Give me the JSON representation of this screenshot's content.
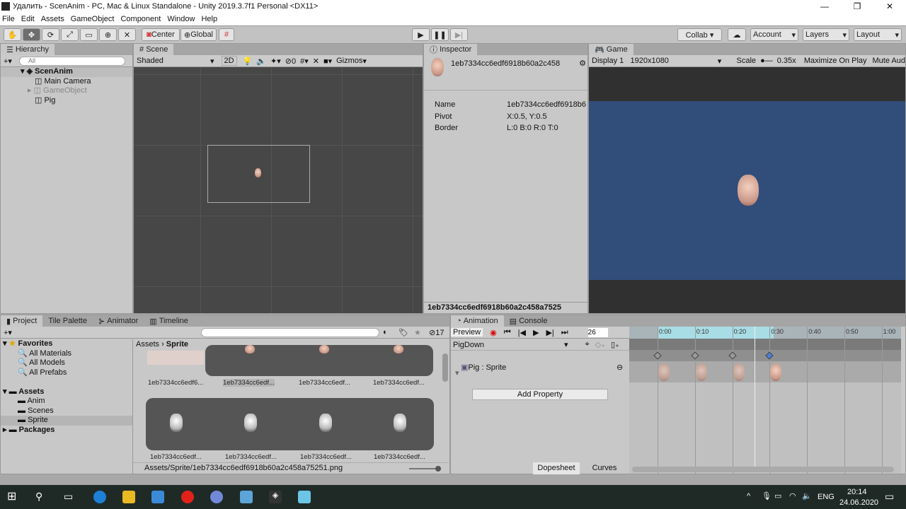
{
  "window": {
    "title": "Удалить - ScenAnim - PC, Mac & Linux Standalone - Unity 2019.3.7f1 Personal <DX11>",
    "controls": [
      "—",
      "❐",
      "✕"
    ]
  },
  "menu": [
    "File",
    "Edit",
    "Assets",
    "GameObject",
    "Component",
    "Window",
    "Help"
  ],
  "toolbar": {
    "tools": [
      "hand-tool",
      "move-tool",
      "rotate-tool",
      "scale-tool",
      "rect-tool",
      "transform-tool",
      "custom-tool"
    ],
    "center": "Center",
    "global": "Global",
    "collab": "Collab ▾",
    "account": "Account",
    "layers": "Layers",
    "layout": "Layout",
    "play_mode": "stopped"
  },
  "hierarchy": {
    "tab": "Hierarchy",
    "search_placeholder": "All",
    "items": [
      {
        "label": "ScenAnim",
        "depth": 0,
        "bold": true
      },
      {
        "label": "Main Camera",
        "depth": 1
      },
      {
        "label": "GameObject",
        "depth": 1,
        "disabled": true
      },
      {
        "label": "Pig",
        "depth": 1
      }
    ]
  },
  "scene": {
    "tab": "Scene",
    "shading": "Shaded",
    "mode2d": "2D",
    "hidden_count": "0",
    "gizmos": "Gizmos"
  },
  "inspector": {
    "tab": "Inspector",
    "asset_name": "1eb7334cc6edf6918b60a2c458",
    "fields": [
      {
        "label": "Name",
        "value": "1eb7334cc6edf6918b6"
      },
      {
        "label": "Pivot",
        "value": "X:0.5, Y:0.5"
      },
      {
        "label": "Border",
        "value": "L:0 B:0 R:0 T:0"
      }
    ],
    "footer": "1eb7334cc6edf6918b60a2c458a7525"
  },
  "game": {
    "tab": "Game",
    "display": "Display 1",
    "resolution": "1920x1080",
    "scale_label": "Scale",
    "scale_value": "0.35x",
    "maximize": "Maximize On Play",
    "mute": "Mute Aud",
    "bg_color": "#314d79"
  },
  "project": {
    "tabs": [
      "Project",
      "Tile Palette",
      "Animator",
      "Timeline"
    ],
    "hidden_count": "17",
    "favorites": {
      "label": "Favorites",
      "items": [
        "All Materials",
        "All Models",
        "All Prefabs"
      ]
    },
    "assets": {
      "label": "Assets",
      "items": [
        "Anim",
        "Scenes",
        "Sprite"
      ]
    },
    "packages": "Packages",
    "breadcrumb": [
      "Assets",
      "Sprite"
    ],
    "row1_labels": [
      "1eb7334cc6edf6...",
      "1eb7334cc6edf...",
      "1eb7334cc6edf...",
      "1eb7334cc6edf..."
    ],
    "row2_labels": [
      "1eb7334cc6edf...",
      "1eb7334cc6edf...",
      "1eb7334cc6edf...",
      "1eb7334cc6edf..."
    ],
    "path": "Assets/Sprite/1eb7334cc6edf6918b60a2c458a75251.png"
  },
  "animation": {
    "tabs": [
      "Animation",
      "Console"
    ],
    "preview": "Preview",
    "frame": "26",
    "clip": "PigDown",
    "property": "Pig : Sprite",
    "add_property": "Add Property",
    "dopesheet": "Dopesheet",
    "curves": "Curves",
    "ruler": [
      "0:00",
      "0:10",
      "0:20",
      "0:30",
      "0:40",
      "0:50",
      "1:00"
    ],
    "keyframes": [
      0,
      10,
      20,
      30
    ],
    "playhead_frame": 26
  },
  "taskbar": {
    "lang": "ENG",
    "time": "20:14",
    "date": "24.06.2020"
  }
}
